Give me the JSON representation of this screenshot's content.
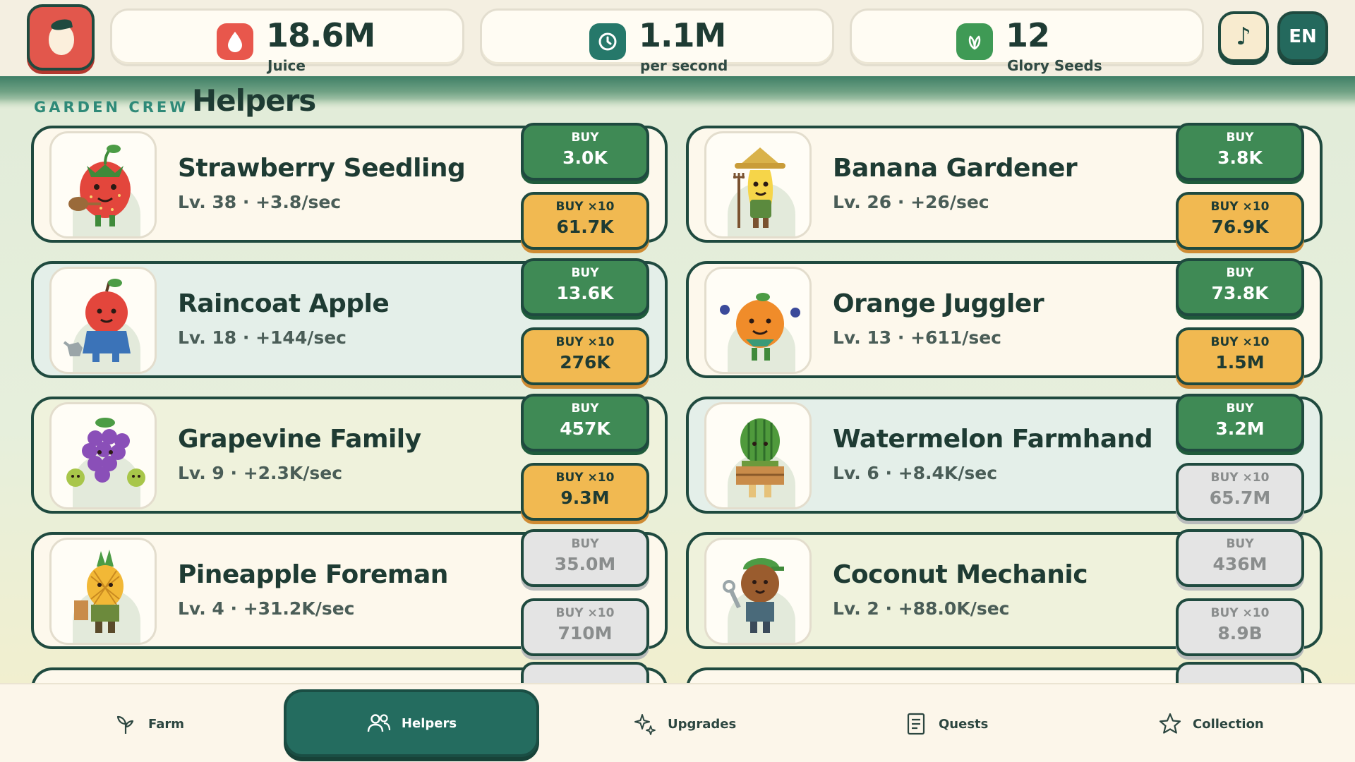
{
  "resources": {
    "juice": {
      "value": "18.6M",
      "label": "Juice",
      "icon": "juice-drop-icon",
      "color": "#e8574c"
    },
    "rate": {
      "value": "1.1M",
      "label": "per second",
      "icon": "clock-icon",
      "color": "#26786a"
    },
    "seeds": {
      "value": "12",
      "label": "Glory Seeds",
      "icon": "leaf-icon",
      "color": "#3f9a55"
    }
  },
  "controls": {
    "music_icon": "music-note-icon",
    "music_glyph": "♪",
    "language": "EN"
  },
  "section": {
    "eyebrow": "GARDEN CREW",
    "title": "Helpers"
  },
  "helpers": [
    {
      "name": "Strawberry Seedling",
      "info": "Lv. 38 · +3.8/sec",
      "buy_label": "BUY",
      "buy_price": "3.0K",
      "buy10_label": "BUY ×10",
      "buy10_price": "61.7K",
      "buy_affordable": true,
      "buy10_affordable": true,
      "portrait": "strawberry-seedling-icon"
    },
    {
      "name": "Banana Gardener",
      "info": "Lv. 26 · +26/sec",
      "buy_label": "BUY",
      "buy_price": "3.8K",
      "buy10_label": "BUY ×10",
      "buy10_price": "76.9K",
      "buy_affordable": true,
      "buy10_affordable": true,
      "portrait": "banana-gardener-icon"
    },
    {
      "name": "Raincoat Apple",
      "info": "Lv. 18 · +144/sec",
      "buy_label": "BUY",
      "buy_price": "13.6K",
      "buy10_label": "BUY ×10",
      "buy10_price": "276K",
      "buy_affordable": true,
      "buy10_affordable": true,
      "portrait": "raincoat-apple-icon"
    },
    {
      "name": "Orange Juggler",
      "info": "Lv. 13 · +611/sec",
      "buy_label": "BUY",
      "buy_price": "73.8K",
      "buy10_label": "BUY ×10",
      "buy10_price": "1.5M",
      "buy_affordable": true,
      "buy10_affordable": true,
      "portrait": "orange-juggler-icon"
    },
    {
      "name": "Grapevine Family",
      "info": "Lv. 9 · +2.3K/sec",
      "buy_label": "BUY",
      "buy_price": "457K",
      "buy10_label": "BUY ×10",
      "buy10_price": "9.3M",
      "buy_affordable": true,
      "buy10_affordable": true,
      "portrait": "grapevine-family-icon"
    },
    {
      "name": "Watermelon Farmhand",
      "info": "Lv. 6 · +8.4K/sec",
      "buy_label": "BUY",
      "buy_price": "3.2M",
      "buy10_label": "BUY ×10",
      "buy10_price": "65.7M",
      "buy_affordable": true,
      "buy10_affordable": false,
      "portrait": "watermelon-farmhand-icon"
    },
    {
      "name": "Pineapple Foreman",
      "info": "Lv. 4 · +31.2K/sec",
      "buy_label": "BUY",
      "buy_price": "35.0M",
      "buy10_label": "BUY ×10",
      "buy10_price": "710M",
      "buy_affordable": false,
      "buy10_affordable": false,
      "portrait": "pineapple-foreman-icon"
    },
    {
      "name": "Coconut Mechanic",
      "info": "Lv. 2 · +88.0K/sec",
      "buy_label": "BUY",
      "buy_price": "436M",
      "buy10_label": "BUY ×10",
      "buy10_price": "8.9B",
      "buy_affordable": false,
      "buy10_affordable": false,
      "portrait": "coconut-mechanic-icon"
    }
  ],
  "nav": [
    {
      "label": "Farm",
      "icon": "sprout-icon",
      "active": false
    },
    {
      "label": "Helpers",
      "icon": "people-icon",
      "active": true
    },
    {
      "label": "Upgrades",
      "icon": "sparkle-icon",
      "active": false
    },
    {
      "label": "Quests",
      "icon": "document-icon",
      "active": false
    },
    {
      "label": "Collection",
      "icon": "star-icon",
      "active": false
    }
  ],
  "colors": {
    "dark_teal": "#1f4a3f",
    "affordable_buy": "#3f8a55",
    "affordable_buy10": "#f1b951",
    "unaffordable": "#e4e4e4",
    "active_nav": "#246c5f"
  }
}
